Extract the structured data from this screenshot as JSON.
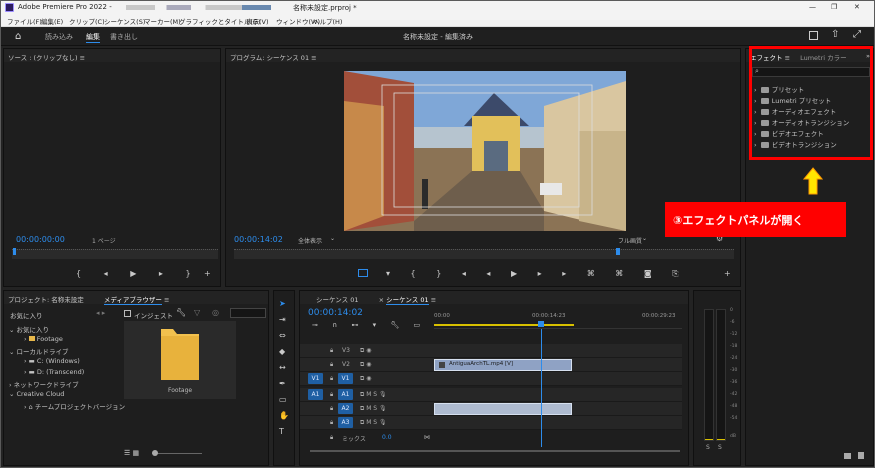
{
  "app": {
    "title": "Adobe Premiere Pro 2022 -",
    "file": "名称未設定.prproj *"
  },
  "menu": [
    "ファイル(F)",
    "編集(E)",
    "クリップ(C)",
    "シーケンス(S)",
    "マーカー(M)",
    "グラフィックとタイトル(G)",
    "表示(V)",
    "ウィンドウ(W)",
    "ヘルプ(H)"
  ],
  "workspace": {
    "tabs": [
      "読み込み",
      "編集",
      "書き出し"
    ],
    "title": "名称未設定 - 編集済み"
  },
  "source": {
    "title": "ソース : (クリップなし)",
    "timecode": "00:00:00:00",
    "page": "1 ページ"
  },
  "program": {
    "title": "プログラム: シーケンス 01",
    "timecode": "00:00:14:02",
    "fit": "全体表示",
    "quality": "フル画質"
  },
  "effects": {
    "tab1": "エフェクト",
    "tab2": "Lumetri カラー",
    "items": [
      "プリセット",
      "Lumetri プリセット",
      "オーディオエフェクト",
      "オーディオトランジション",
      "ビデオエフェクト",
      "ビデオトランジション"
    ]
  },
  "callout": {
    "text": "③エフェクトパネルが開く",
    "color": "#ff0000",
    "arrow_color": "#ffe600"
  },
  "project": {
    "tab1": "プロジェクト: 名称未設定",
    "tab2": "メディアブラウザー",
    "fav": "お気に入り",
    "ingest": "インジェスト",
    "folder_label": "Footage",
    "tree": [
      "お気に入り",
      "Footage",
      "ローカルドライブ",
      "C: (Windows)",
      "D: (Transcend)",
      "ネットワークドライブ",
      "Creative Cloud",
      "チームプロジェクトバージョン"
    ]
  },
  "timeline": {
    "tab1": "シーケンス 01",
    "tab2": "シーケンス 01",
    "timecode": "00:00:14:02",
    "ruler": [
      "00:00",
      "00:00:14:23",
      "00:00:29:23"
    ],
    "video_tracks": [
      "V3",
      "V2",
      "V1"
    ],
    "audio_tracks": [
      "A1",
      "A2",
      "A3"
    ],
    "mix_label": "ミックス",
    "mix_value": "0.0",
    "clip_name": "AntiguaArchTL.mp4 [V]",
    "src_v": "V1",
    "src_a": "A1"
  },
  "meter": {
    "labels": [
      "0",
      "-6",
      "-12",
      "-18",
      "-24",
      "-30",
      "-36",
      "-42",
      "-48",
      "-54",
      "dB"
    ],
    "solo": [
      "S",
      "S"
    ]
  }
}
